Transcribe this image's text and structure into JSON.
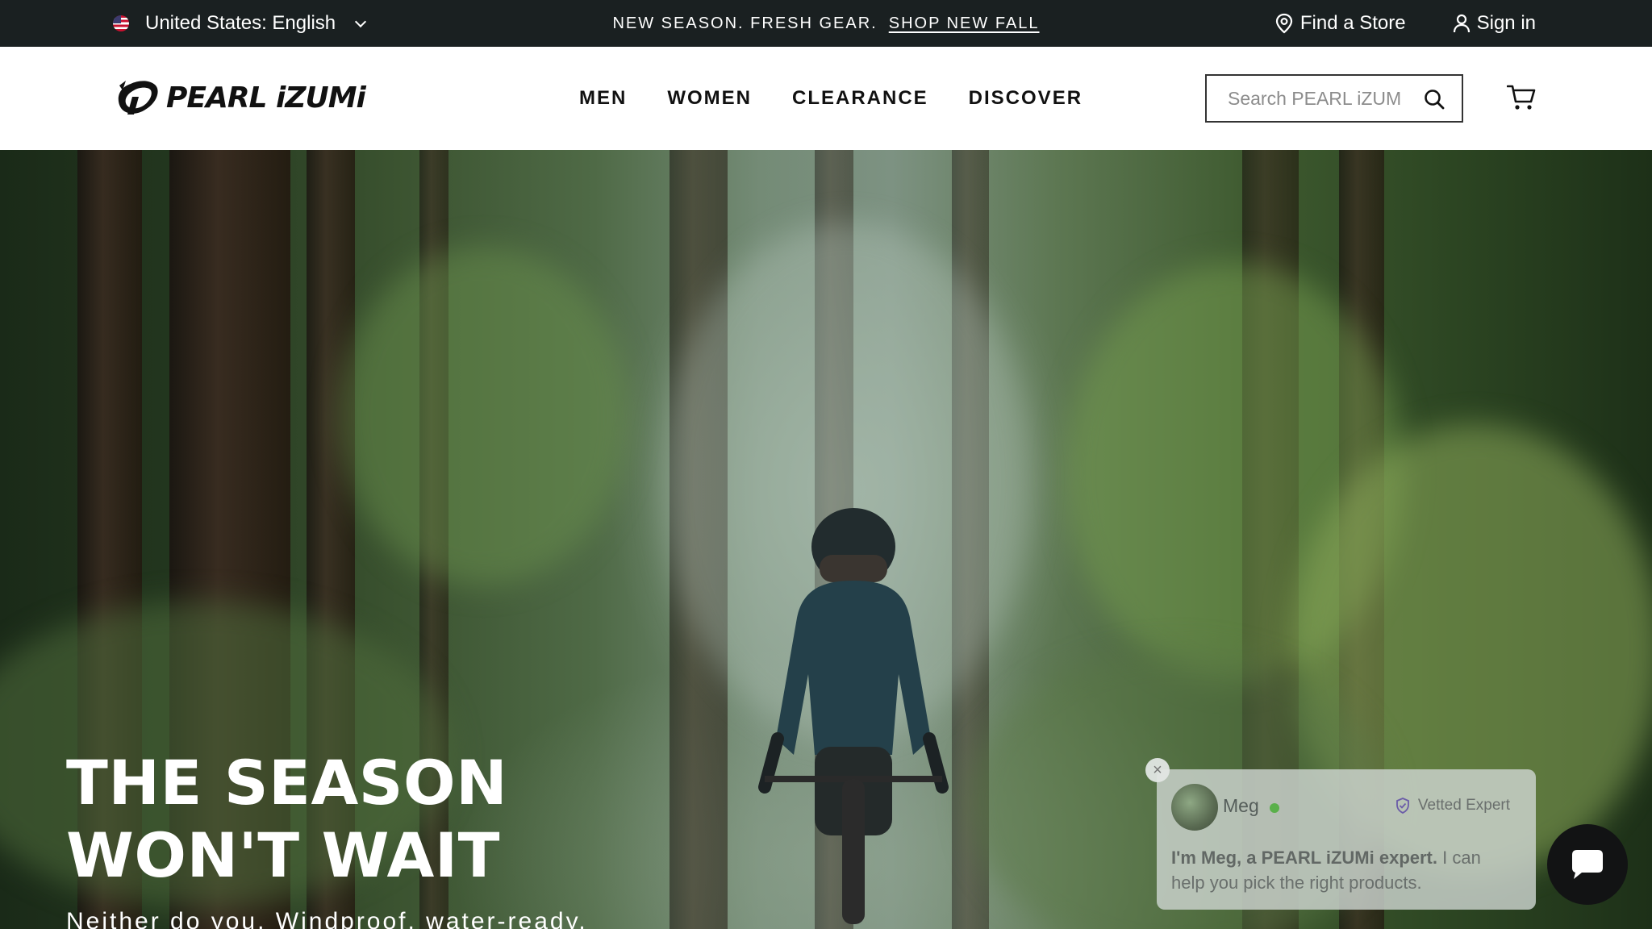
{
  "promo_bar": {
    "locale_label": "United States: English",
    "message": "NEW SEASON. FRESH GEAR.",
    "link_label": "SHOP NEW FALL",
    "find_store_label": "Find a Store",
    "sign_in_label": "Sign in"
  },
  "header": {
    "logo_text": "PEARL iZUMi",
    "nav": [
      "MEN",
      "WOMEN",
      "CLEARANCE",
      "DISCOVER"
    ],
    "search_placeholder": "Search PEARL iZUMi"
  },
  "hero": {
    "title": "THE SEASON WON'T WAIT",
    "subtitle": "Neither do you. Windproof, water-ready."
  },
  "chat": {
    "close_glyph": "×",
    "expert_name": "Meg",
    "badge": "Vetted Expert",
    "message_bold": "I'm Meg, a PEARL iZUMi expert.",
    "message_rest": " I can help you pick the right products."
  },
  "colors": {
    "promo_bar_bg": "#1a2021",
    "header_bg": "#ffffff",
    "online": "#5ab04a",
    "chat_button": "#121314"
  },
  "icons": {
    "locale": "us-flag-icon",
    "dropdown": "chevron-down-icon",
    "store": "location-pin-icon",
    "account": "user-icon",
    "search": "search-icon",
    "cart": "cart-icon",
    "close": "close-icon",
    "badge": "shield-check-icon",
    "chat": "chat-bubble-icon"
  }
}
